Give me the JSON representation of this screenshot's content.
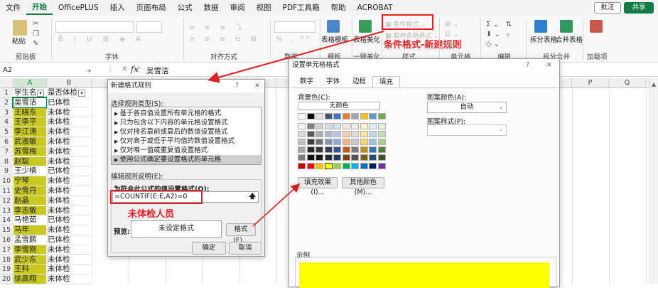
{
  "tabs": [
    "文件",
    "开始",
    "OfficePLUS",
    "插入",
    "页面布局",
    "公式",
    "数据",
    "审阅",
    "视图",
    "PDF工具箱",
    "帮助",
    "ACROBAT"
  ],
  "tabs_active": 1,
  "ribbon_right": {
    "comment": "批注",
    "share": "共享"
  },
  "ribbon": {
    "paste": "粘贴",
    "clipboard": "剪贴板",
    "font": "字体",
    "align": "对齐方式",
    "number": "数字",
    "template": "模板",
    "table_template": "表格模板",
    "table_beautify": "表格美化",
    "one_key": "一键美化",
    "cond_format": "条件格式",
    "cell_style": "套用表格格式",
    "style": "样式",
    "cells": "单元格",
    "edit": "编辑",
    "split_table": "拆分表格",
    "merge_table": "合并表格",
    "split_merge": "拆分合并",
    "addins": "加载项"
  },
  "annot_ribbon": "条件格式-新建规则",
  "annot_formula": "未体检人员",
  "formula_bar": {
    "cell_ref": "A2",
    "fx": "fx",
    "value": "吴雪洁"
  },
  "columns": [
    "A",
    "B",
    "C",
    "D",
    "E",
    "F",
    "G",
    "H",
    "I",
    "J",
    "K",
    "L",
    "M",
    "N",
    "O",
    "P",
    "Q",
    "R"
  ],
  "rows": [
    {
      "n": "1",
      "a": "学生名",
      "b": "是否体检"
    },
    {
      "n": "2",
      "a": "吴雪洁",
      "b": "已体检",
      "hl": false
    },
    {
      "n": "3",
      "a": "王晓东",
      "b": "未体检",
      "hl": true
    },
    {
      "n": "4",
      "a": "王李平",
      "b": "未体检",
      "hl": true
    },
    {
      "n": "5",
      "a": "李江涛",
      "b": "未体检",
      "hl": true
    },
    {
      "n": "6",
      "a": "武淑敏",
      "b": "未体检",
      "hl": true
    },
    {
      "n": "7",
      "a": "苏雪梅",
      "b": "未体检",
      "hl": true
    },
    {
      "n": "8",
      "a": "赵聪",
      "b": "未体检",
      "hl": true
    },
    {
      "n": "9",
      "a": "王少楠",
      "b": "已体检",
      "hl": false
    },
    {
      "n": "10",
      "a": "宁琴",
      "b": "未体检",
      "hl": true
    },
    {
      "n": "11",
      "a": "史雪丹",
      "b": "未体检",
      "hl": true
    },
    {
      "n": "12",
      "a": "赵晶",
      "b": "未体检",
      "hl": true
    },
    {
      "n": "13",
      "a": "李志敏",
      "b": "未体检",
      "hl": true
    },
    {
      "n": "14",
      "a": "马艳茹",
      "b": "已体检",
      "hl": false
    },
    {
      "n": "15",
      "a": "马年",
      "b": "未体检",
      "hl": true
    },
    {
      "n": "16",
      "a": "孟雪鹏",
      "b": "已体检",
      "hl": false
    },
    {
      "n": "17",
      "a": "李雪刚",
      "b": "未体检",
      "hl": true
    },
    {
      "n": "18",
      "a": "武少东",
      "b": "未体检",
      "hl": true
    },
    {
      "n": "19",
      "a": "王科",
      "b": "未体检",
      "hl": true
    },
    {
      "n": "20",
      "a": "徐高翔",
      "b": "未体检",
      "hl": true
    }
  ],
  "colors": {
    "highlight": "#c8c81e",
    "preview": "#ffff00",
    "annot": "#e02020",
    "green": "#107c41"
  },
  "new_rule": {
    "title": "新建格式规则",
    "help": "?",
    "close": "✕",
    "select_type": "选择规则类型(S):",
    "types": [
      "基于各自值设置所有单元格的格式",
      "只为包含以下内容的单元格设置格式",
      "仅对排名靠前或靠后的数值设置格式",
      "仅对高于或低于平均值的数值设置格式",
      "仅对唯一值或重复值设置格式",
      "使用公式确定要设置格式的单元格"
    ],
    "selected_type": 5,
    "edit_desc": "编辑规则说明(E):",
    "formula_label": "为符合此公式的值设置格式(O):",
    "formula": "=COUNTIF(E:E,A2)=0",
    "preview_label": "预览:",
    "preview_text": "未设定格式",
    "format_btn": "格式(F)...",
    "ok": "确定",
    "cancel": "取消"
  },
  "format_cells": {
    "title": "设置单元格格式",
    "help": "?",
    "close": "✕",
    "tabs": [
      "数字",
      "字体",
      "边框",
      "填充"
    ],
    "active_tab": 3,
    "bg_label": "背景色(C):",
    "no_color": "无颜色",
    "fill_effects": "填充效果(I)...",
    "more_colors": "其他颜色(M)...",
    "pattern_color_label": "图案颜色(A):",
    "pattern_color": "自动",
    "pattern_style_label": "图案样式(P):",
    "sample": "示例"
  }
}
